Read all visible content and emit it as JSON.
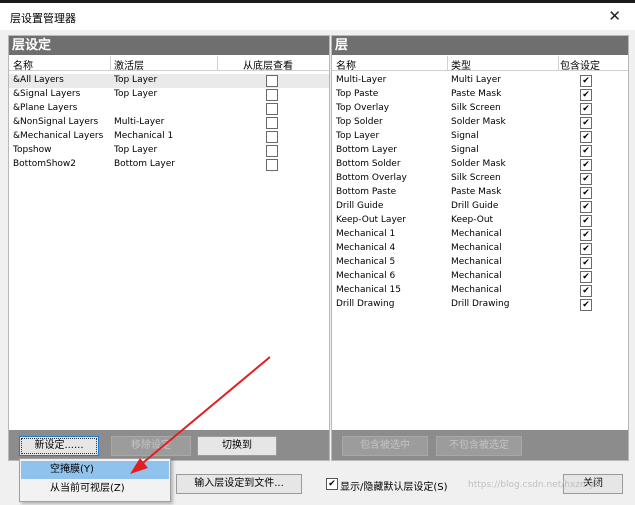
{
  "window": {
    "title": "层设置管理器",
    "close_glyph": "✕"
  },
  "left_panel": {
    "header": "层设定",
    "columns": [
      "名称",
      "激活层",
      "从底层查看"
    ],
    "rows": [
      {
        "name": "&All Layers",
        "active": "Top Layer",
        "view_from_bottom": false
      },
      {
        "name": "&Signal Layers",
        "active": "Top Layer",
        "view_from_bottom": false
      },
      {
        "name": "&Plane Layers",
        "active": "",
        "view_from_bottom": false
      },
      {
        "name": "&NonSignal Layers",
        "active": "Multi-Layer",
        "view_from_bottom": false
      },
      {
        "name": "&Mechanical Layers",
        "active": "Mechanical 1",
        "view_from_bottom": false
      },
      {
        "name": "Topshow",
        "active": "Top Layer",
        "view_from_bottom": false
      },
      {
        "name": "BottomShow2",
        "active": "Bottom Layer",
        "view_from_bottom": false
      }
    ],
    "buttons": {
      "new": "新设定......",
      "remove": "移除设定",
      "switch": "切换到"
    }
  },
  "right_panel": {
    "header": "层",
    "columns": [
      "名称",
      "类型",
      "包含设定"
    ],
    "rows": [
      {
        "name": "Multi-Layer",
        "type": "Multi Layer",
        "included": true
      },
      {
        "name": "Top Paste",
        "type": "Paste Mask",
        "included": true
      },
      {
        "name": "Top Overlay",
        "type": "Silk Screen",
        "included": true
      },
      {
        "name": "Top Solder",
        "type": "Solder Mask",
        "included": true
      },
      {
        "name": "Top Layer",
        "type": "Signal",
        "included": true
      },
      {
        "name": "Bottom Layer",
        "type": "Signal",
        "included": true
      },
      {
        "name": "Bottom Solder",
        "type": "Solder Mask",
        "included": true
      },
      {
        "name": "Bottom Overlay",
        "type": "Silk Screen",
        "included": true
      },
      {
        "name": "Bottom Paste",
        "type": "Paste Mask",
        "included": true
      },
      {
        "name": "Drill Guide",
        "type": "Drill Guide",
        "included": true
      },
      {
        "name": "Keep-Out Layer",
        "type": "Keep-Out",
        "included": true
      },
      {
        "name": "Mechanical 1",
        "type": "Mechanical",
        "included": true
      },
      {
        "name": "Mechanical 4",
        "type": "Mechanical",
        "included": true
      },
      {
        "name": "Mechanical 5",
        "type": "Mechanical",
        "included": true
      },
      {
        "name": "Mechanical 6",
        "type": "Mechanical",
        "included": true
      },
      {
        "name": "Mechanical 15",
        "type": "Mechanical",
        "included": true
      },
      {
        "name": "Drill Drawing",
        "type": "Drill Drawing",
        "included": true
      }
    ],
    "buttons": {
      "include_selected": "包含被选中",
      "exclude_selected": "不包含被选定"
    }
  },
  "popup_menu": {
    "items": [
      "空掩膜(Y)",
      "从当前可视层(Z)"
    ],
    "highlighted_index": 0
  },
  "bottom_bar": {
    "import_button": "输入层设定到文件...",
    "show_hide_checkbox": {
      "label": "显示/隐藏默认层设定(S)",
      "checked": true
    },
    "close_button": "关闭"
  },
  "watermark": "https://blog.csdn.net/hxzmy8"
}
